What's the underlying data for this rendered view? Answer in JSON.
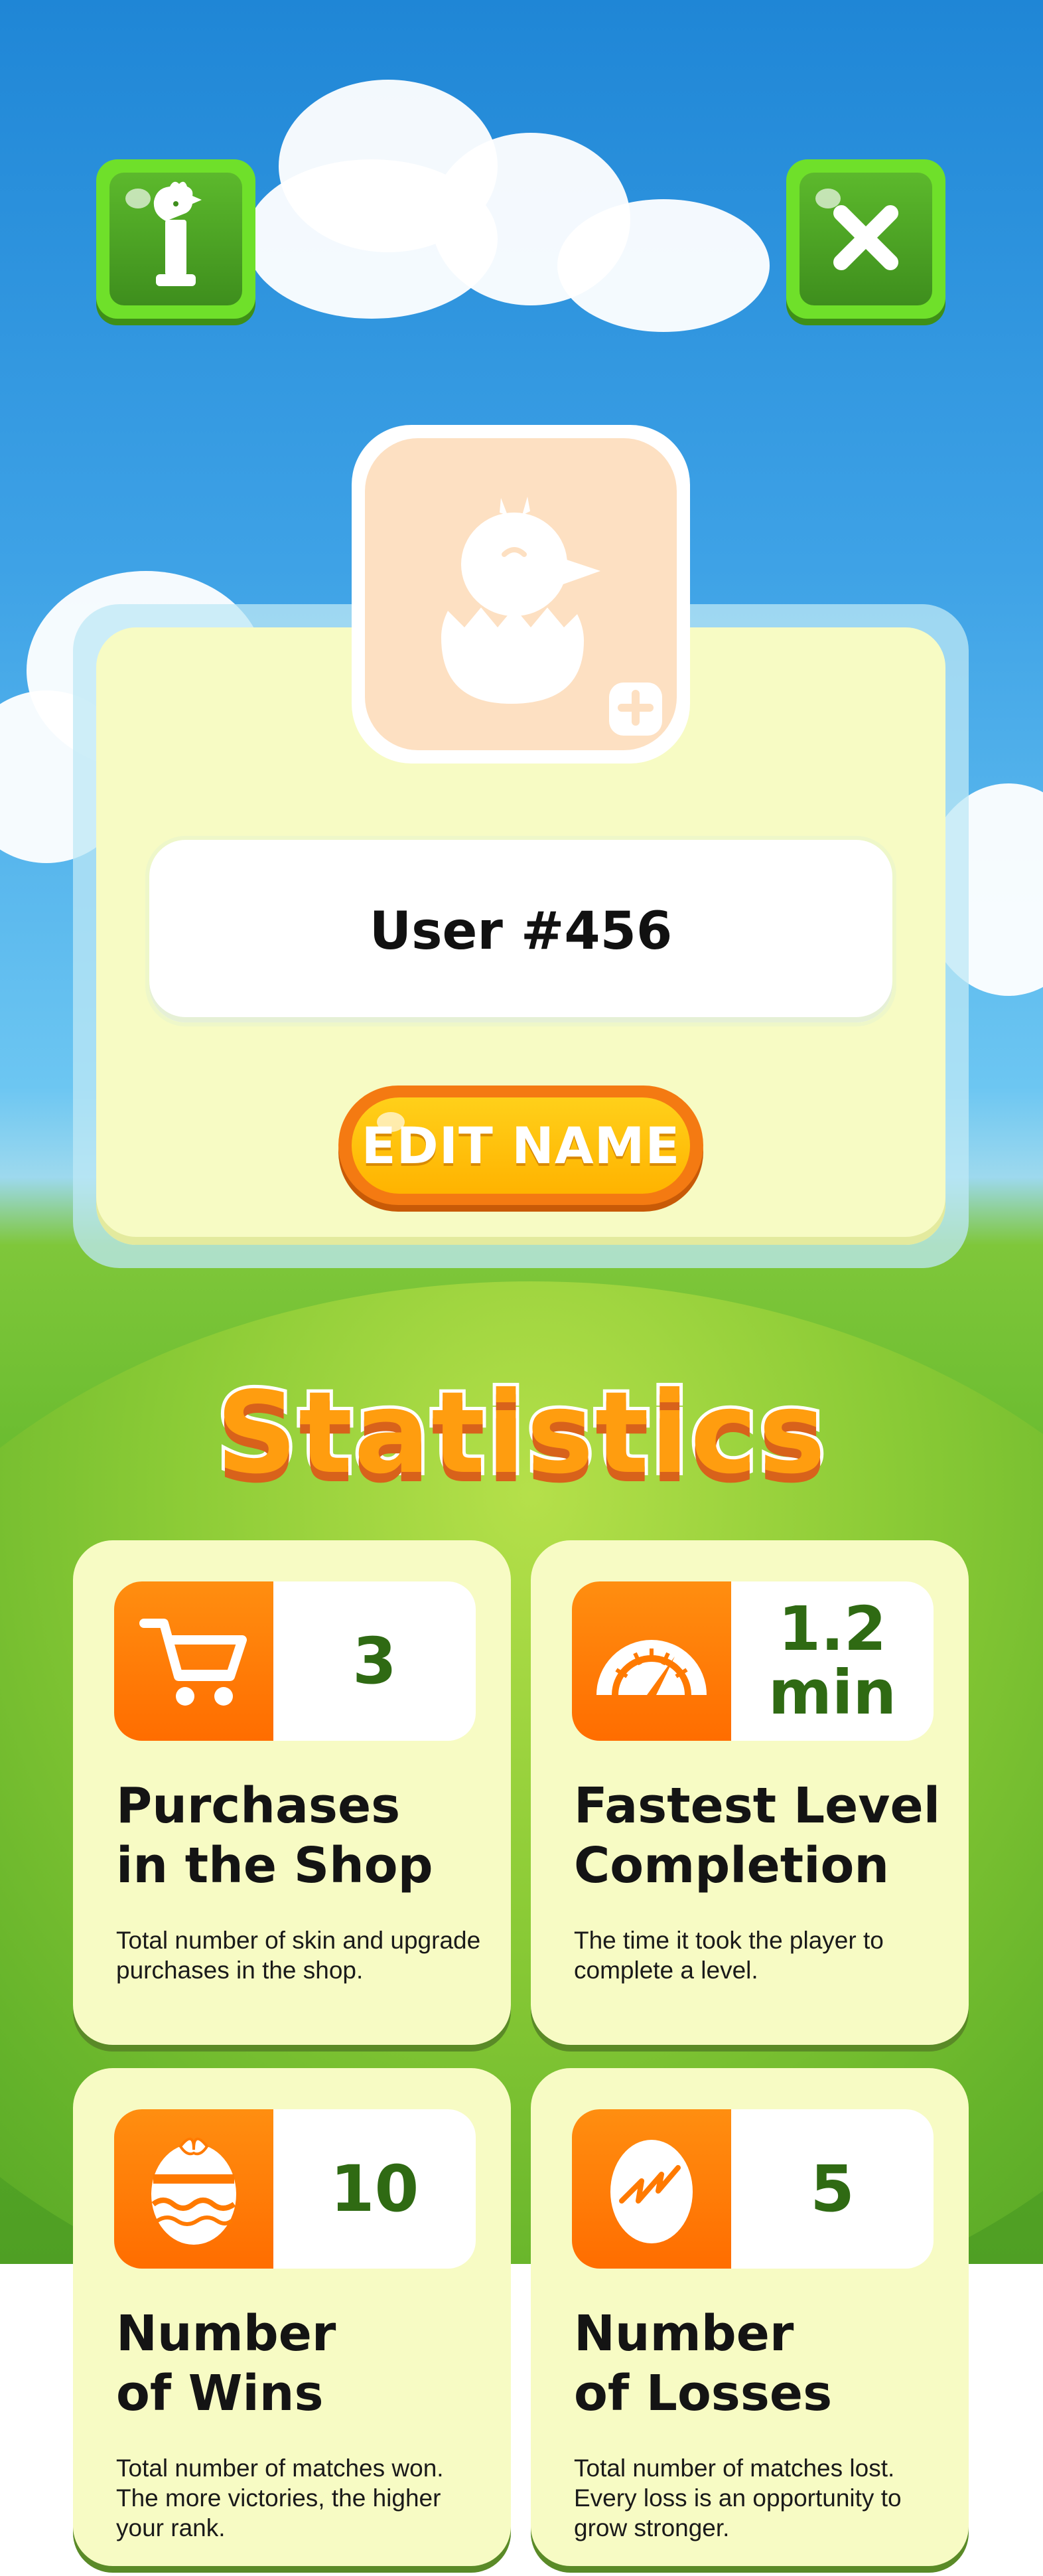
{
  "header": {
    "info_icon": "chicken-info-icon",
    "close_icon": "close-x-icon",
    "button_color": "#6fe02a"
  },
  "profile": {
    "avatar_icon": "hatching-chick-icon",
    "avatar_add_icon": "plus-icon",
    "username": "User #456",
    "edit_button_label": "EDIT NAME"
  },
  "statistics": {
    "title": "Statistics",
    "cards": [
      {
        "icon": "shopping-cart-icon",
        "value": "3",
        "title_line1": "Purchases",
        "title_line2": "in the Shop",
        "description": "Total number of skin and upgrade purchases in the shop."
      },
      {
        "icon": "speedometer-icon",
        "value_line1": "1.2",
        "value_line2": "min",
        "title_line1": "Fastest Level",
        "title_line2": "Completion",
        "description": "The time it took the player to complete a level."
      },
      {
        "icon": "easter-egg-icon",
        "value": "10",
        "title_line1": "Number",
        "title_line2": "of Wins",
        "description": "Total number of matches won. The more victories, the higher your rank."
      },
      {
        "icon": "cracked-egg-icon",
        "value": "5",
        "title_line1": "Number",
        "title_line2": "of Losses",
        "description": "Total number of matches lost. Every loss is an opportunity to grow stronger."
      }
    ]
  },
  "colors": {
    "accent_orange": "#ff7a00",
    "value_green": "#2f6a13",
    "card_bg": "#f7fbc4"
  }
}
